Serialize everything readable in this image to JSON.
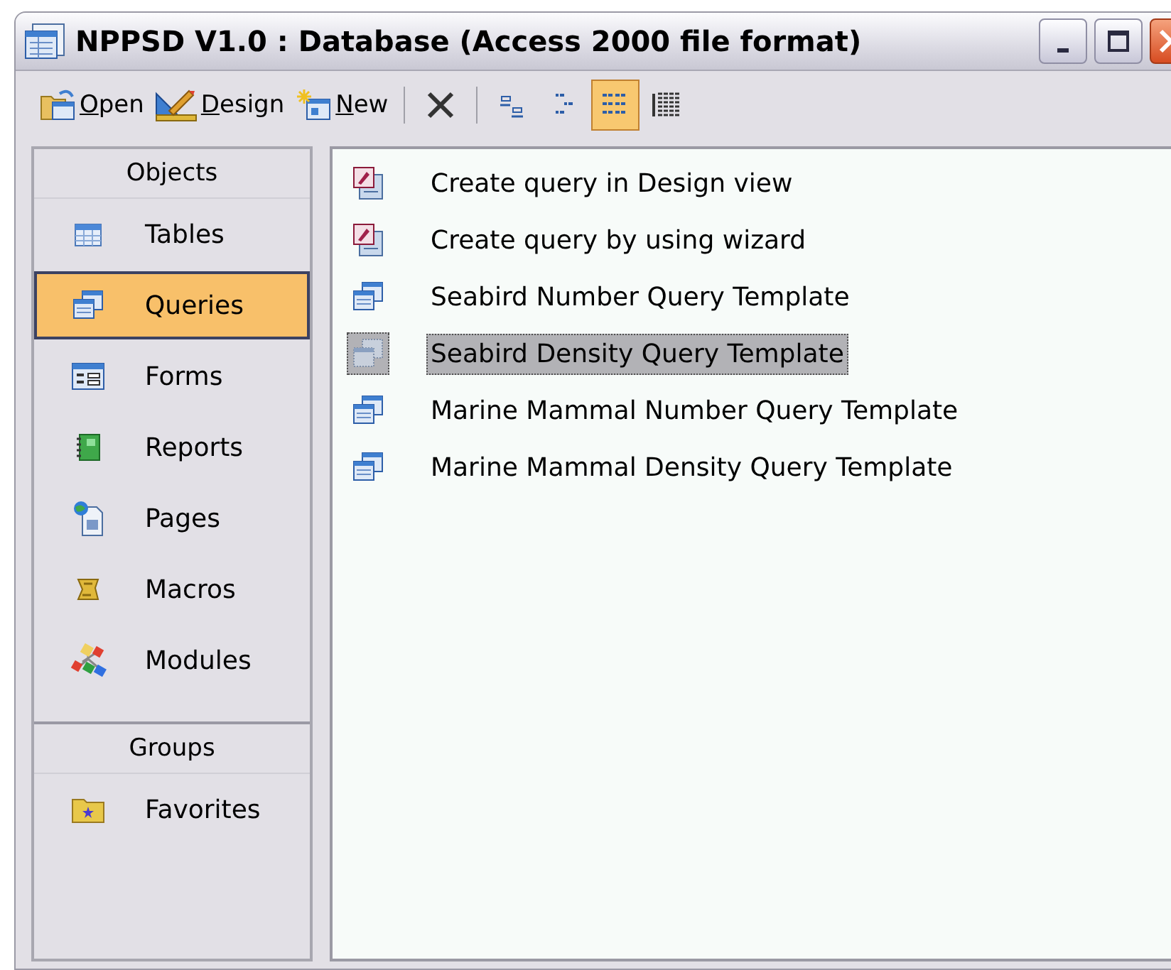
{
  "window": {
    "title": "NPPSD V1.0 : Database (Access 2000 file format)"
  },
  "toolbar": [
    {
      "kind": "button",
      "label": "Open",
      "selected": false
    },
    {
      "kind": "button",
      "label": "Design",
      "selected": false
    },
    {
      "kind": "button",
      "label": "New",
      "selected": false
    },
    {
      "kind": "separator"
    },
    {
      "kind": "delete",
      "selected": false
    },
    {
      "kind": "separator"
    },
    {
      "kind": "large-icons",
      "selected": false
    },
    {
      "kind": "small-icons",
      "selected": false
    },
    {
      "kind": "list",
      "selected": true
    },
    {
      "kind": "details",
      "selected": false
    }
  ],
  "sidebar": {
    "sections": [
      {
        "title": "Objects",
        "items": [
          {
            "label": "Tables",
            "selected": false
          },
          {
            "label": "Queries",
            "selected": true
          },
          {
            "label": "Forms",
            "selected": false
          },
          {
            "label": "Reports",
            "selected": false
          },
          {
            "label": "Pages",
            "selected": false
          },
          {
            "label": "Macros",
            "selected": false
          },
          {
            "label": "Modules",
            "selected": false
          }
        ]
      },
      {
        "title": "Groups",
        "items": [
          {
            "label": "Favorites",
            "selected": false
          }
        ]
      }
    ]
  },
  "objects": [
    {
      "kind": "wizard",
      "label": "Create query in Design view",
      "selected": false
    },
    {
      "kind": "wizard",
      "label": "Create query by using wizard",
      "selected": false
    },
    {
      "kind": "query",
      "label": "Seabird Number Query Template",
      "selected": false
    },
    {
      "kind": "query",
      "label": "Seabird Density Query Template",
      "selected": true
    },
    {
      "kind": "query",
      "label": "Marine Mammal Number Query Template",
      "selected": false
    },
    {
      "kind": "query",
      "label": "Marine Mammal Density Query Template",
      "selected": false
    }
  ]
}
